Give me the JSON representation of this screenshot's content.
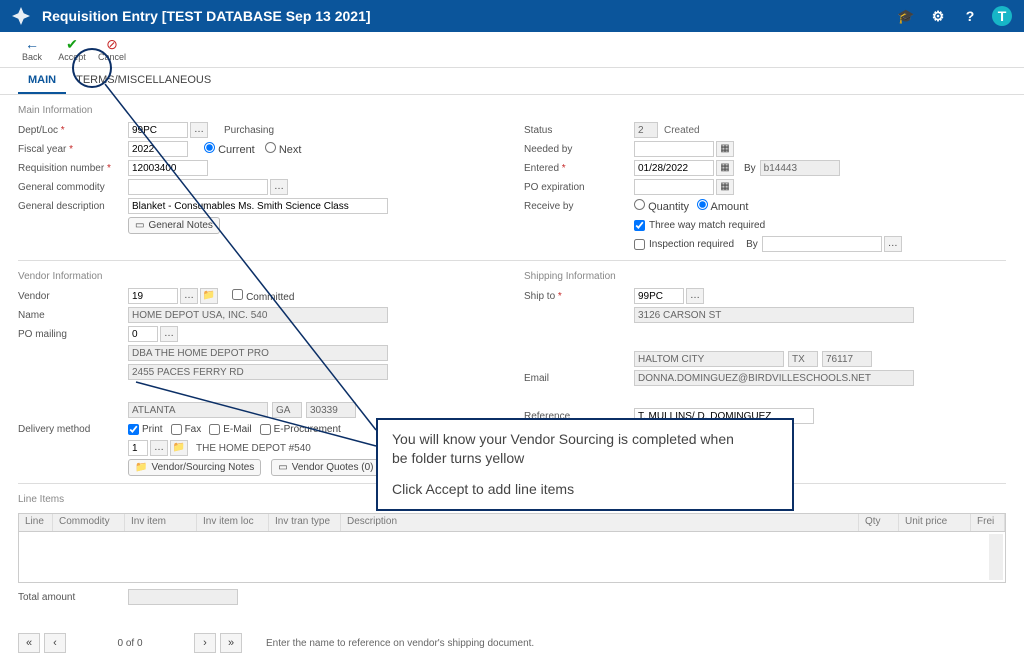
{
  "title": "Requisition Entry [TEST DATABASE Sep 13 2021]",
  "avatar": "T",
  "toolbar": {
    "back": "Back",
    "accept": "Accept",
    "cancel": "Cancel"
  },
  "tabs": {
    "main": "MAIN",
    "terms": "TERMS/MISCELLANEOUS"
  },
  "sections": {
    "main": "Main Information",
    "vendor": "Vendor Information",
    "ship": "Shipping Information",
    "line": "Line Items"
  },
  "labels": {
    "dept": "Dept/Loc",
    "fiscal": "Fiscal year",
    "reqnum": "Requisition number",
    "gcomm": "General commodity",
    "gdesc": "General description",
    "purch": "Purchasing",
    "current": "Current",
    "next": "Next",
    "gnotes": "General Notes",
    "status": "Status",
    "needed": "Needed by",
    "entered": "Entered",
    "poexp": "PO expiration",
    "recv": "Receive by",
    "by": "By",
    "qty": "Quantity",
    "amt": "Amount",
    "threeway": "Three way match required",
    "insp": "Inspection required",
    "vendor": "Vendor",
    "name": "Name",
    "pomail": "PO mailing",
    "committed": "Committed",
    "delivery": "Delivery method",
    "print": "Print",
    "fax": "Fax",
    "email": "E-Mail",
    "eproc": "E-Procurement",
    "vsnotes": "Vendor/Sourcing Notes",
    "vquotes": "Vendor Quotes (0)",
    "shipto": "Ship to",
    "emailL": "Email",
    "ref": "Reference",
    "total": "Total amount",
    "created": "Created"
  },
  "values": {
    "dept": "99PC",
    "fiscal": "2022",
    "reqnum": "12003400",
    "gdesc": "Blanket - Consumables Ms. Smith Science Class",
    "status": "2",
    "entered": "01/28/2022",
    "enteredby": "b14443",
    "vendorid": "19",
    "vendorname": "HOME DEPOT USA, INC. 540",
    "pomail": "0",
    "dba": "DBA THE HOME DEPOT PRO",
    "addr1": "2455 PACES FERRY RD",
    "city": "ATLANTA",
    "state": "GA",
    "zip": "30339",
    "delivnum": "1",
    "delivname": "THE HOME DEPOT #540",
    "shipcode": "99PC",
    "shipaddr": "3126 CARSON ST",
    "shipcity": "HALTOM CITY",
    "shipstate": "TX",
    "shipzip": "76117",
    "shipemail": "DONNA.DOMINGUEZ@BIRDVILLESCHOOLS.NET",
    "reference": "T. MULLINS/ D. DOMINGUEZ"
  },
  "grid": {
    "cols": [
      "Line",
      "Commodity",
      "Inv item",
      "Inv item loc",
      "Inv tran type",
      "Description",
      "Qty",
      "Unit price",
      "Frei"
    ]
  },
  "pager": {
    "text": "0 of 0"
  },
  "hint": "Enter the name to reference on vendor's shipping document.",
  "callout": {
    "l1": "You will know your Vendor Sourcing is completed when",
    "l2": "be folder turns yellow",
    "l3": "Click Accept to add line items"
  }
}
